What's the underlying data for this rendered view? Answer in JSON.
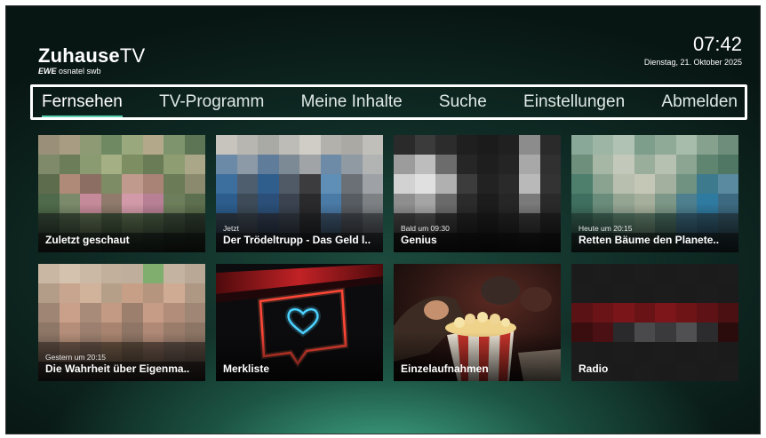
{
  "header": {
    "logo_main": "Zuhause",
    "logo_tv": "TV",
    "logo_sub_ewe": "EWE",
    "logo_sub_rest": "osnatel swb",
    "time": "07:42",
    "date": "Dienstag, 21. Oktober 2025"
  },
  "nav": {
    "items": [
      {
        "label": "Fernsehen",
        "active": true
      },
      {
        "label": "TV-Programm",
        "active": false
      },
      {
        "label": "Meine Inhalte",
        "active": false
      },
      {
        "label": "Suche",
        "active": false
      },
      {
        "label": "Einstellungen",
        "active": false
      },
      {
        "label": "Abmelden",
        "active": false
      }
    ],
    "accent_color": "#59d1b2"
  },
  "tiles": [
    {
      "subtitle": "",
      "title": "Zuletzt geschaut",
      "icon": "pixelated-thumbnail"
    },
    {
      "subtitle": "Jetzt",
      "title": "Der Trödeltrupp - Das Geld l..",
      "icon": "pixelated-thumbnail"
    },
    {
      "subtitle": "Bald um 09:30",
      "title": "Genius",
      "icon": "pixelated-thumbnail"
    },
    {
      "subtitle": "Heute um 20:15",
      "title": "Retten Bäume den Planete..",
      "icon": "pixelated-thumbnail"
    },
    {
      "subtitle": "Gestern um 20:15",
      "title": "Die Wahrheit über Eigenma..",
      "icon": "pixelated-thumbnail"
    },
    {
      "subtitle": "",
      "title": "Merkliste",
      "icon": "heart-icon"
    },
    {
      "subtitle": "",
      "title": "Einzelaufnahmen",
      "icon": "popcorn-icon"
    },
    {
      "subtitle": "",
      "title": "Radio",
      "icon": "pixelated-thumbnail"
    }
  ]
}
